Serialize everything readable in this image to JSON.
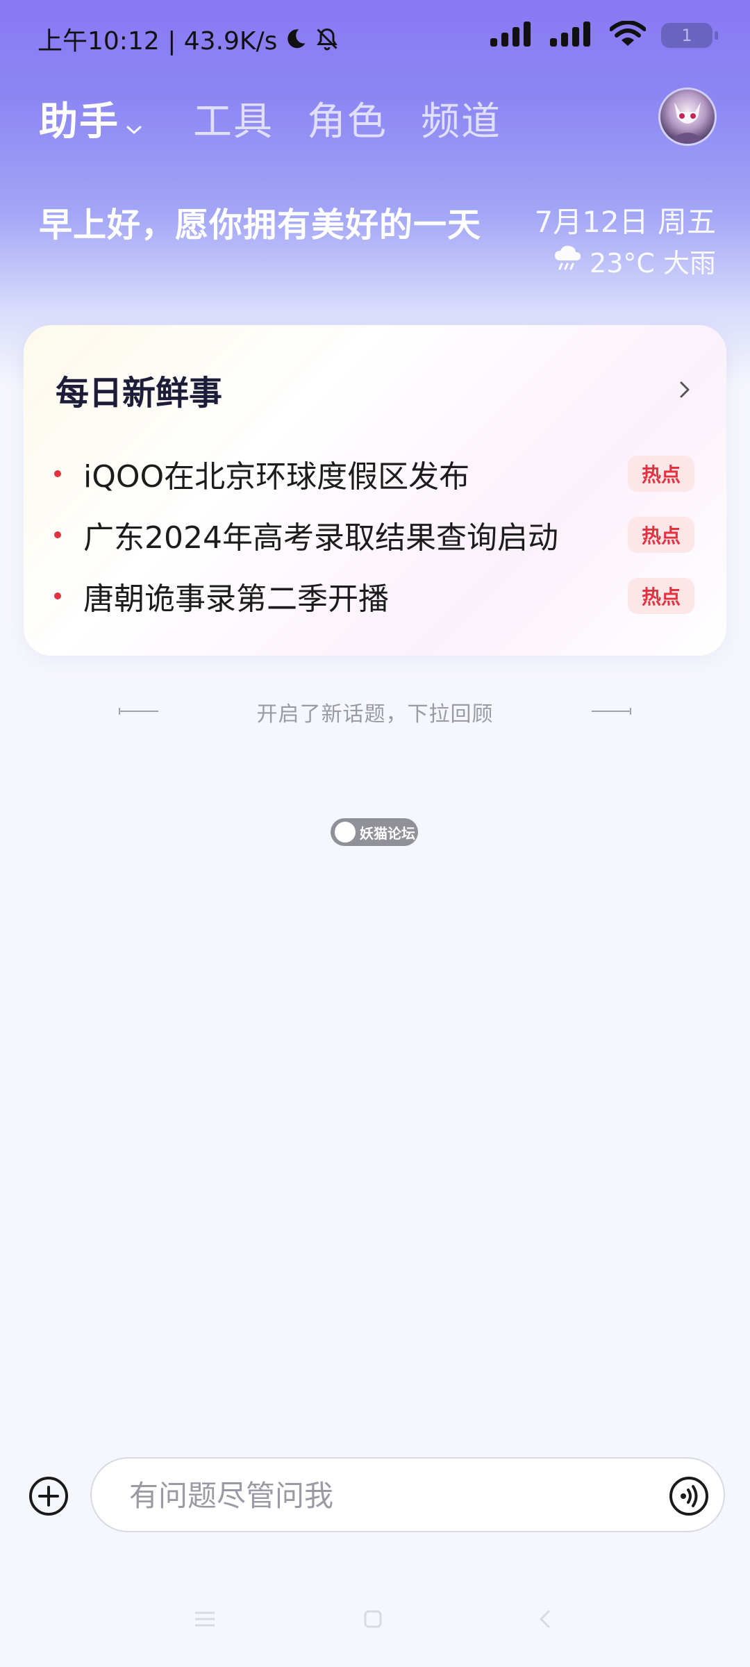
{
  "status_bar": {
    "time_speed": "上午10:12 | 43.9K/s",
    "battery_level": "1",
    "icons": [
      "moon-icon",
      "bell-off-icon",
      "signal-icon",
      "signal-icon",
      "wifi-icon",
      "battery-icon"
    ]
  },
  "nav": {
    "tabs": [
      {
        "label": "助手",
        "active": true
      },
      {
        "label": "工具",
        "active": false
      },
      {
        "label": "角色",
        "active": false
      },
      {
        "label": "频道",
        "active": false
      }
    ]
  },
  "header": {
    "greeting": "早上好，愿你拥有美好的一天",
    "date": "7月12日 周五",
    "weather": "23°C 大雨",
    "weather_icon": "rain-cloud-icon"
  },
  "news": {
    "title": "每日新鲜事",
    "items": [
      {
        "text": "iQOO在北京环球度假区发布",
        "badge": "热点"
      },
      {
        "text": "广东2024年高考录取结果查询启动",
        "badge": "热点"
      },
      {
        "text": "唐朝诡事录第二季开播",
        "badge": "热点"
      }
    ],
    "accent_color": "#e0333f"
  },
  "divider": {
    "text": "开启了新话题，下拉回顾"
  },
  "watermark": {
    "text": "妖猫论坛"
  },
  "composer": {
    "placeholder": "有问题尽管问我"
  },
  "colors": {
    "header_gradient_top": "#8a78f4",
    "background": "#f6f7fc",
    "hot_badge_bg": "#fde6e8",
    "hot_badge_text": "#e5313f"
  }
}
